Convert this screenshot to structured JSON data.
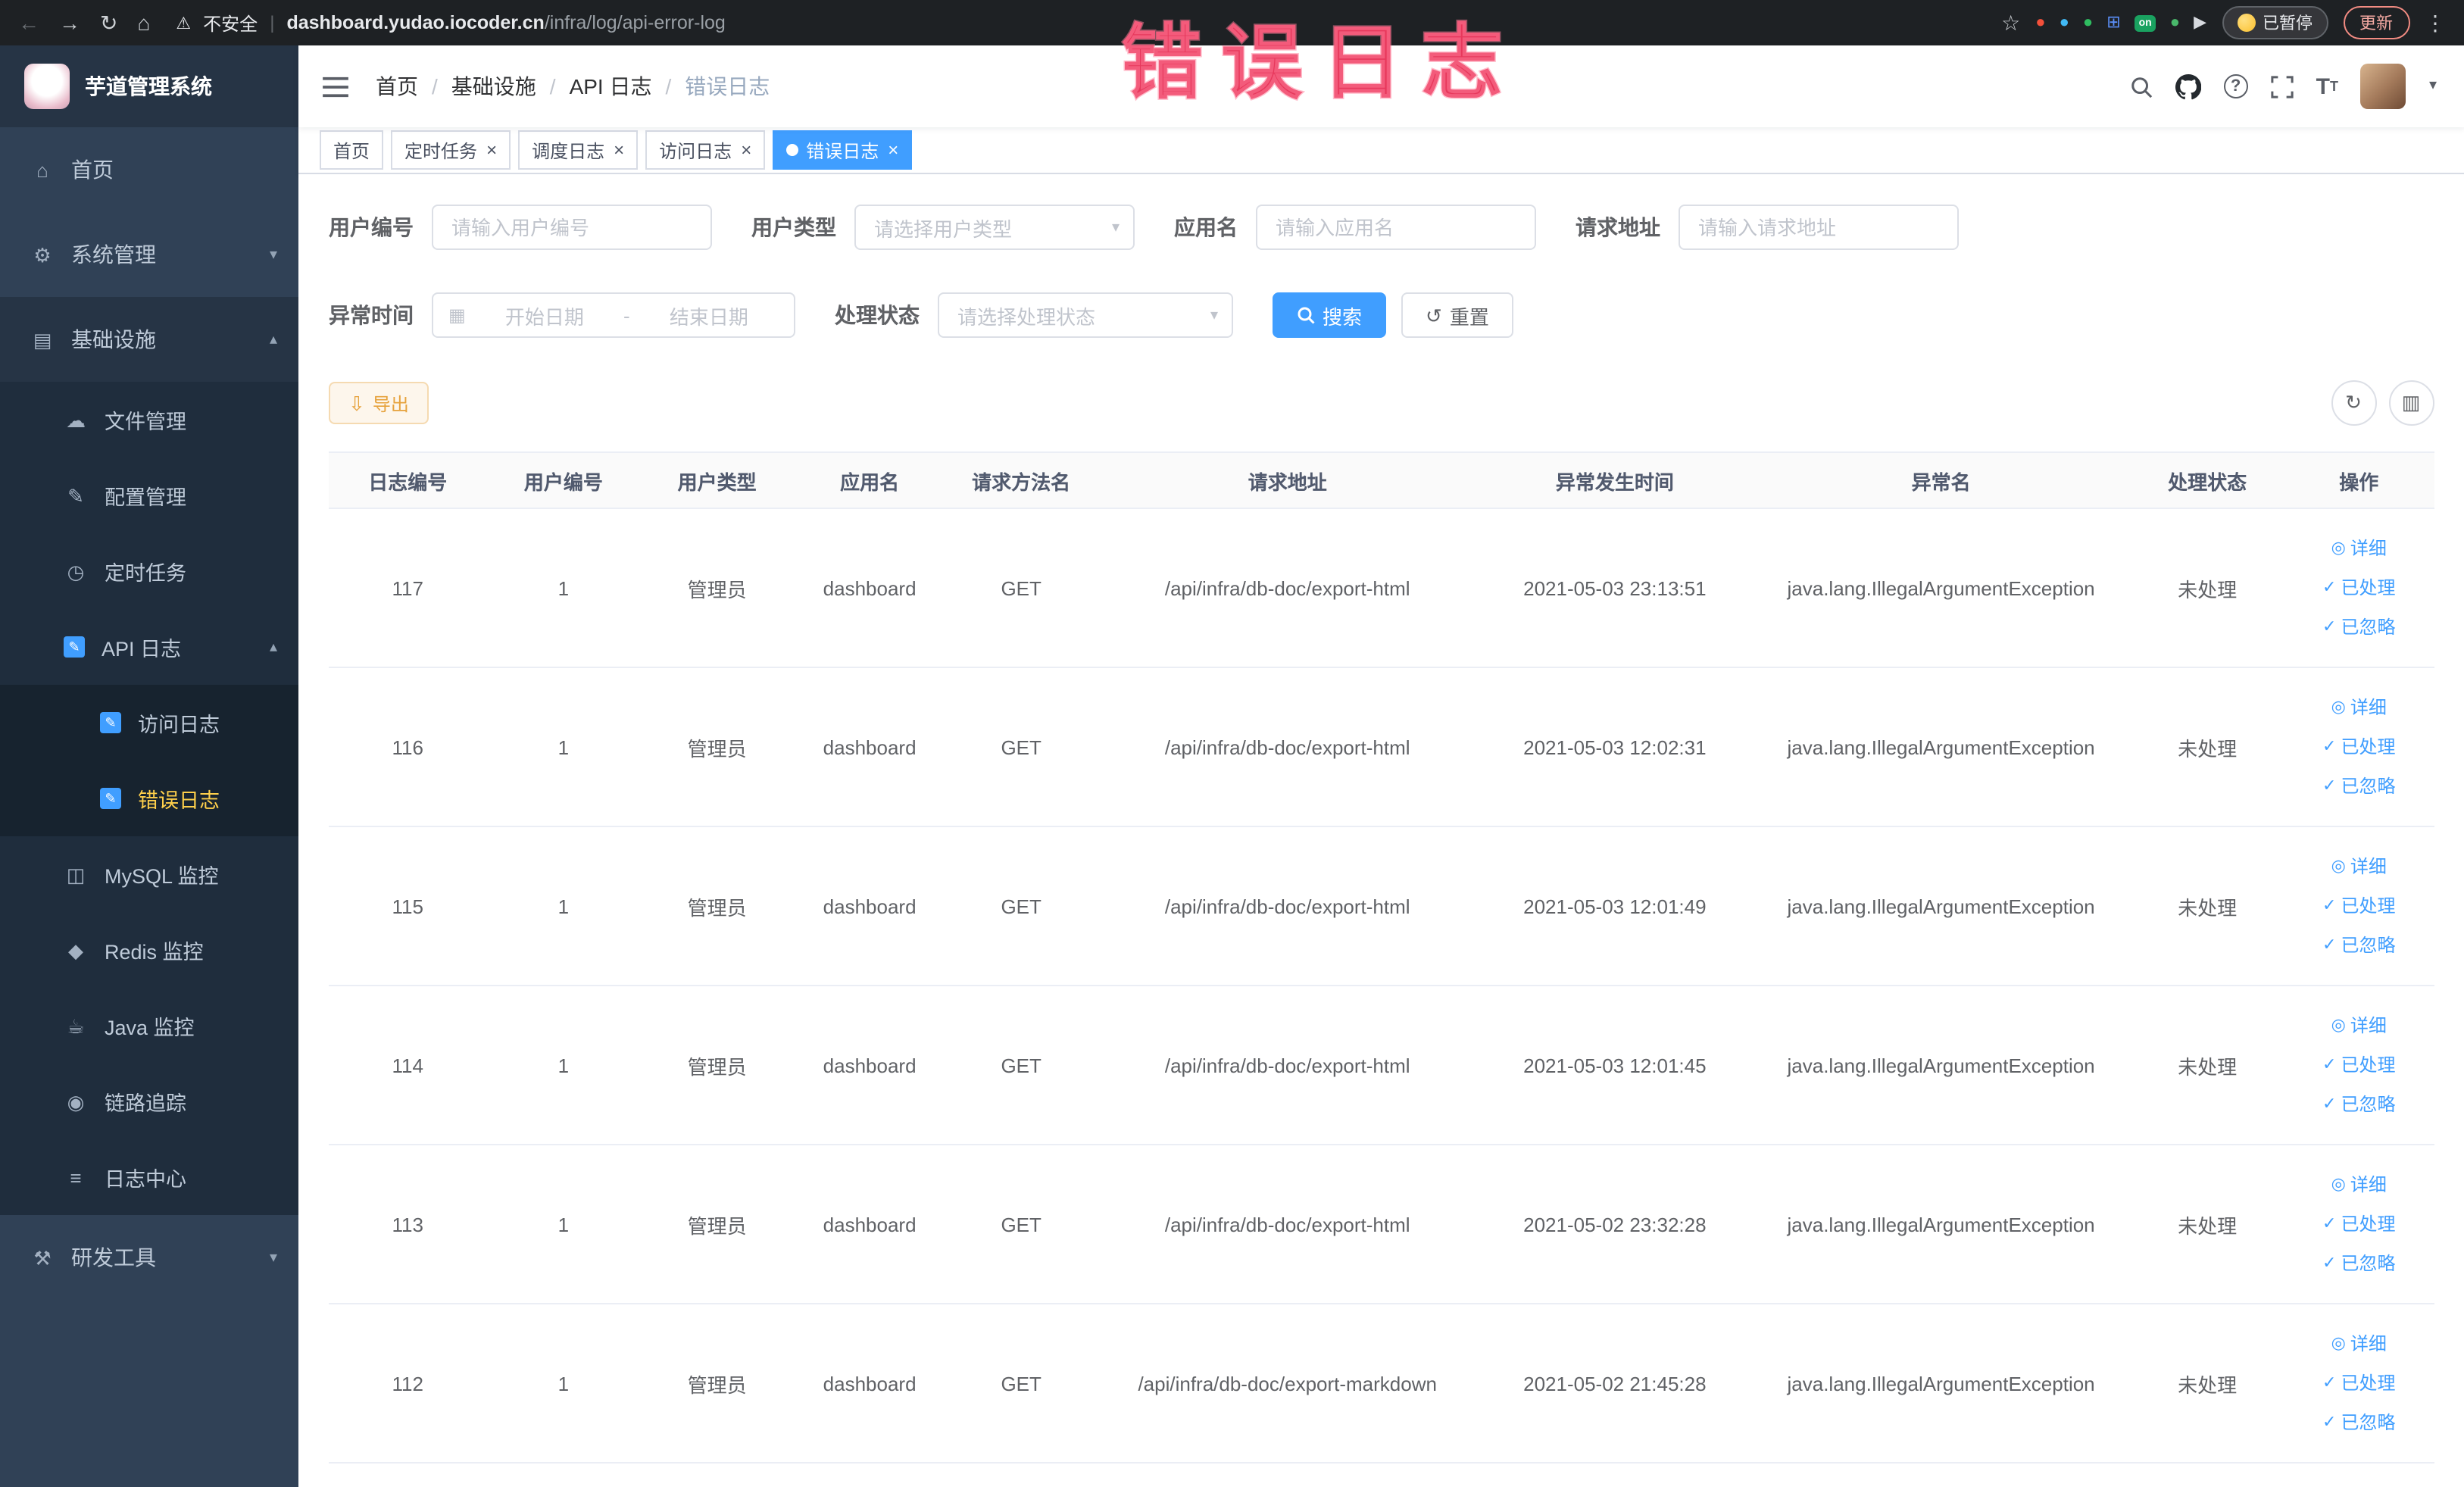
{
  "browser": {
    "security_label": "不安全",
    "url_host": "dashboard.yudao.iocoder.cn",
    "url_path": "/infra/log/api-error-log",
    "paused_badge": "已暂停",
    "update_button": "更新",
    "extensions": [
      {
        "name": "extension-red-circle-icon",
        "glyph": "●",
        "color": "#f4503a"
      },
      {
        "name": "extension-blue-drop-icon",
        "glyph": "●",
        "color": "#41b9f5"
      },
      {
        "name": "extension-green-circle-icon",
        "glyph": "●",
        "color": "#2fbd60"
      },
      {
        "name": "extension-blue-grid-icon",
        "glyph": "⊞",
        "color": "#5b8ff9"
      },
      {
        "name": "extension-on-badge-icon",
        "glyph": "on",
        "color": "#1aa260",
        "badge": true
      },
      {
        "name": "extension-leaf-icon",
        "glyph": "●",
        "color": "#49b86b"
      },
      {
        "name": "extension-pointer-icon",
        "glyph": "▶",
        "color": "#d7dadf"
      }
    ]
  },
  "sidebar": {
    "logo_title": "芋道管理系统",
    "items": [
      {
        "key": "home",
        "label": "首页",
        "icon": "home-icon",
        "level": 1
      },
      {
        "key": "system-management",
        "label": "系统管理",
        "icon": "gear-icon",
        "level": 1,
        "chevron": "down"
      },
      {
        "key": "infrastructure",
        "label": "基础设施",
        "icon": "infra-icon",
        "level": 1,
        "chevron": "up",
        "open": true
      },
      {
        "key": "file-management",
        "label": "文件管理",
        "icon": "file-icon",
        "level": 2
      },
      {
        "key": "config-management",
        "label": "配置管理",
        "icon": "config-icon",
        "level": 2
      },
      {
        "key": "scheduled-jobs",
        "label": "定时任务",
        "icon": "job-icon",
        "level": 2
      },
      {
        "key": "api-log",
        "label": "API 日志",
        "icon": "api-log-icon",
        "level": 2,
        "chevron": "up",
        "open": true
      },
      {
        "key": "access-log",
        "label": "访问日志",
        "icon": "access-log-icon",
        "level": 3
      },
      {
        "key": "error-log",
        "label": "错误日志",
        "icon": "error-log-icon",
        "level": 3,
        "active": true
      },
      {
        "key": "mysql-monitor",
        "label": "MySQL 监控",
        "icon": "mysql-icon",
        "level": 2
      },
      {
        "key": "redis-monitor",
        "label": "Redis 监控",
        "icon": "redis-icon",
        "level": 2
      },
      {
        "key": "java-monitor",
        "label": "Java 监控",
        "icon": "java-icon",
        "level": 2
      },
      {
        "key": "trace",
        "label": "链路追踪",
        "icon": "trace-icon",
        "level": 2
      },
      {
        "key": "log-center",
        "label": "日志中心",
        "icon": "log-center-icon",
        "level": 2
      },
      {
        "key": "dev-tools",
        "label": "研发工具",
        "icon": "devtools-icon",
        "level": 1,
        "chevron": "down"
      }
    ]
  },
  "navbar": {
    "breadcrumb": [
      "首页",
      "基础设施",
      "API 日志",
      "错误日志"
    ]
  },
  "annotation": "错误日志",
  "tabs": [
    {
      "key": "home",
      "label": "首页",
      "closable": false,
      "active": false
    },
    {
      "key": "scheduled-jobs",
      "label": "定时任务",
      "closable": true,
      "active": false
    },
    {
      "key": "job-log",
      "label": "调度日志",
      "closable": true,
      "active": false
    },
    {
      "key": "access-log",
      "label": "访问日志",
      "closable": true,
      "active": false
    },
    {
      "key": "error-log",
      "label": "错误日志",
      "closable": true,
      "active": true
    }
  ],
  "filters": {
    "user_id_label": "用户编号",
    "user_id_placeholder": "请输入用户编号",
    "user_type_label": "用户类型",
    "user_type_placeholder": "请选择用户类型",
    "app_name_label": "应用名",
    "app_name_placeholder": "请输入应用名",
    "request_url_label": "请求地址",
    "request_url_placeholder": "请输入请求地址",
    "exception_time_label": "异常时间",
    "range_start_placeholder": "开始日期",
    "range_separator": "-",
    "range_end_placeholder": "结束日期",
    "process_status_label": "处理状态",
    "process_status_placeholder": "请选择处理状态",
    "search_button": "搜索",
    "reset_button": "重置"
  },
  "toolbar": {
    "export_button": "导出"
  },
  "table": {
    "headers": [
      "日志编号",
      "用户编号",
      "用户类型",
      "应用名",
      "请求方法名",
      "请求地址",
      "异常发生时间",
      "异常名",
      "处理状态",
      "操作"
    ],
    "action_labels": {
      "detail": "详细",
      "processed": "已处理",
      "ignored": "已忽略"
    },
    "rows": [
      {
        "log_id": "117",
        "user_id": "1",
        "user_type": "管理员",
        "app_name": "dashboard",
        "method": "GET",
        "url": "/api/infra/db-doc/export-html",
        "time": "2021-05-03 23:13:51",
        "exception": "java.lang.IllegalArgumentException",
        "status": "未处理"
      },
      {
        "log_id": "116",
        "user_id": "1",
        "user_type": "管理员",
        "app_name": "dashboard",
        "method": "GET",
        "url": "/api/infra/db-doc/export-html",
        "time": "2021-05-03 12:02:31",
        "exception": "java.lang.IllegalArgumentException",
        "status": "未处理"
      },
      {
        "log_id": "115",
        "user_id": "1",
        "user_type": "管理员",
        "app_name": "dashboard",
        "method": "GET",
        "url": "/api/infra/db-doc/export-html",
        "time": "2021-05-03 12:01:49",
        "exception": "java.lang.IllegalArgumentException",
        "status": "未处理"
      },
      {
        "log_id": "114",
        "user_id": "1",
        "user_type": "管理员",
        "app_name": "dashboard",
        "method": "GET",
        "url": "/api/infra/db-doc/export-html",
        "time": "2021-05-03 12:01:45",
        "exception": "java.lang.IllegalArgumentException",
        "status": "未处理"
      },
      {
        "log_id": "113",
        "user_id": "1",
        "user_type": "管理员",
        "app_name": "dashboard",
        "method": "GET",
        "url": "/api/infra/db-doc/export-html",
        "time": "2021-05-02 23:32:28",
        "exception": "java.lang.IllegalArgumentException",
        "status": "未处理"
      },
      {
        "log_id": "112",
        "user_id": "1",
        "user_type": "管理员",
        "app_name": "dashboard",
        "method": "GET",
        "url": "/api/infra/db-doc/export-markdown",
        "time": "2021-05-02 21:45:28",
        "exception": "java.lang.IllegalArgumentException",
        "status": "未处理"
      }
    ]
  },
  "colors": {
    "primary": "#409eff",
    "sidebar_bg": "#304156",
    "submenu_bg": "#1f2d3d",
    "active_menu_text": "#ffd04b",
    "warning_button_text": "#e6a23c",
    "annotation": "#e7385c"
  }
}
